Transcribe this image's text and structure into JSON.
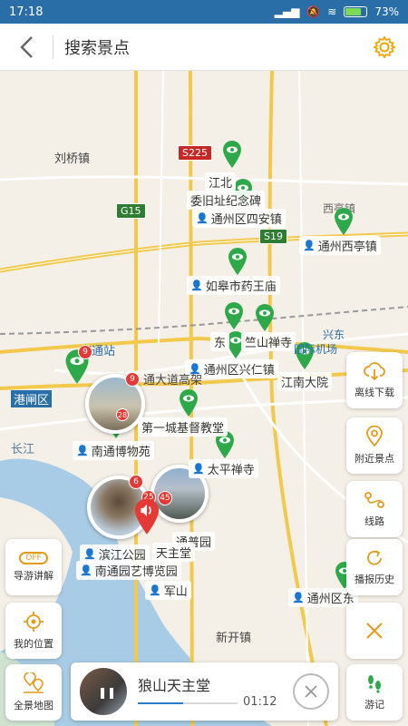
{
  "status": {
    "time": "17:18",
    "battery": "73%"
  },
  "header": {
    "title": "搜索景点"
  },
  "map": {
    "towns": [
      "刘桥镇",
      "新开镇",
      "长江",
      "港闸区",
      "南通站",
      "西亭镇"
    ],
    "roads": [
      "S225",
      "G15",
      "S19"
    ],
    "poi_labels": {
      "jiangbei": "江北",
      "weijiuzhi": "委旧址纪念碑",
      "sian": "通州区四安镇",
      "xiting": "通州西亭镇",
      "yaowangmiao": "如皋市药王庙",
      "zhushan": "竺山禅寺",
      "xingren": "通州区兴仁镇",
      "jiangnan": "江南大院",
      "dongxing": "东",
      "airport_partial": "兴东",
      "airport_partial2": "国际机场",
      "dadao": "通大道高架",
      "church": "第一城基督教堂",
      "museum": "南通博物苑",
      "taiping": "太平禅寺",
      "binjiang": "滨江公园",
      "tianzhutang": "天主堂",
      "yiyuan": "南通园艺博览园",
      "junshan": "军山",
      "tongzhou_right": "通州区东",
      "zhongyuan": "通普园"
    },
    "badges": [
      "9",
      "9",
      "28",
      "6",
      "25",
      "45"
    ]
  },
  "side_buttons": {
    "offline": "离线下载",
    "nearby": "附近景点",
    "route": "线路",
    "history": "播报历史",
    "close": "",
    "youji": "游记",
    "guide": "导游讲解",
    "guide_toggle": "OFF",
    "location": "我的位置",
    "fullmap": "全景地图"
  },
  "player": {
    "name": "狼山天主堂",
    "time": "01:12",
    "progress": 0.45
  },
  "colors": {
    "accent": "#2a6ea8",
    "marker_green": "#2ea94a",
    "marker_red": "#e53935",
    "gear": "#f0a500"
  }
}
